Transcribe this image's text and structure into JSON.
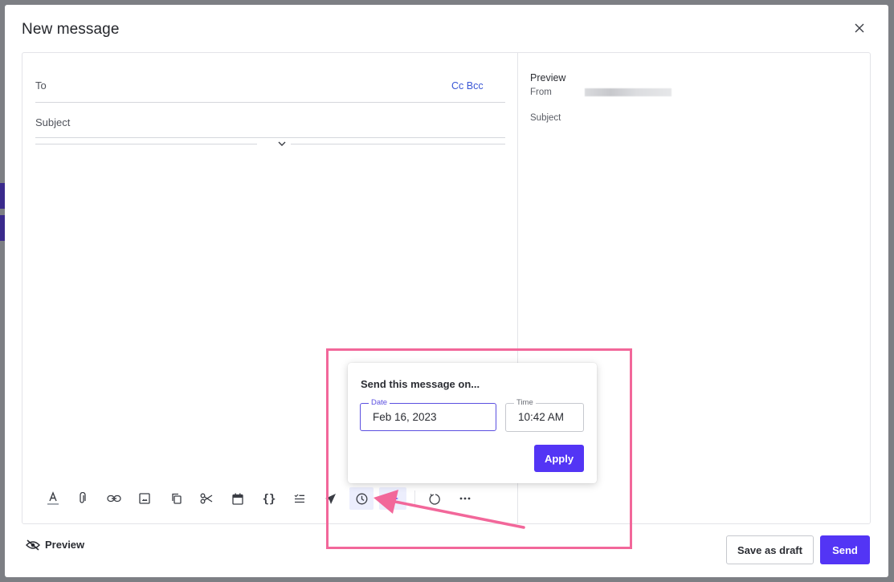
{
  "modal": {
    "title": "New message"
  },
  "compose": {
    "to_label": "To",
    "cc_bcc_label": "Cc Bcc",
    "subject_label": "Subject"
  },
  "preview_pane": {
    "title": "Preview",
    "from_label": "From",
    "subject_label": "Subject"
  },
  "toolbar": {
    "icons": [
      "text-format-icon",
      "attachment-icon",
      "link-icon",
      "image-icon",
      "copy-icon",
      "scissors-icon",
      "calendar-icon",
      "braces-icon",
      "checklist-icon",
      "paper-plane-icon",
      "clock-icon",
      "send-arrow-icon",
      "undo-icon",
      "more-icon"
    ],
    "active_icon": "clock-icon"
  },
  "schedule_popover": {
    "title": "Send this message on...",
    "date_label": "Date",
    "date_value": "Feb 16, 2023",
    "time_label": "Time",
    "time_value": "10:42 AM",
    "apply_label": "Apply"
  },
  "footer": {
    "preview_toggle_label": "Preview",
    "save_draft_label": "Save as draft",
    "send_label": "Send"
  },
  "colors": {
    "primary": "#5335f5",
    "link": "#3a57d6",
    "annotation": "#f2679a",
    "backdrop": "#7d7f84"
  }
}
